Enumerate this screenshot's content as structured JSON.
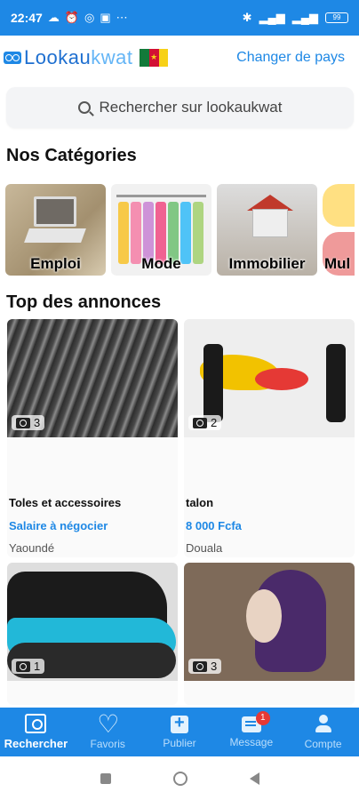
{
  "status_bar": {
    "time": "22:47",
    "battery": "99"
  },
  "header": {
    "logo_part1": "Look",
    "logo_part2": "au",
    "logo_part3": "kwat",
    "change_country": "Changer de pays"
  },
  "search": {
    "placeholder": "Rechercher sur lookaukwat"
  },
  "categories": {
    "title": "Nos Catégories",
    "items": [
      {
        "label": "Emploi"
      },
      {
        "label": "Mode"
      },
      {
        "label": "Immobilier"
      },
      {
        "label": "Mul"
      }
    ]
  },
  "listings": {
    "title": "Top des annonces",
    "items": [
      {
        "photo_count": "3",
        "title": "Toles et accessoires",
        "price": "Salaire à négocier",
        "location": "Yaoundé"
      },
      {
        "photo_count": "2",
        "title": "talon",
        "price": "8 000 Fcfa",
        "location": "Douala"
      },
      {
        "photo_count": "1",
        "title": "",
        "price": "",
        "location": ""
      },
      {
        "photo_count": "3",
        "title": "",
        "price": "",
        "location": ""
      }
    ]
  },
  "tabbar": {
    "items": [
      {
        "label": "Rechercher",
        "icon": "search-icon",
        "active": true
      },
      {
        "label": "Favoris",
        "icon": "heart-icon"
      },
      {
        "label": "Publier",
        "icon": "plus-icon"
      },
      {
        "label": "Message",
        "icon": "message-icon",
        "badge": "1"
      },
      {
        "label": "Compte",
        "icon": "user-icon"
      }
    ]
  },
  "colors": {
    "primary": "#1e88e5",
    "price": "#1e88e5",
    "badge": "#e53935"
  }
}
